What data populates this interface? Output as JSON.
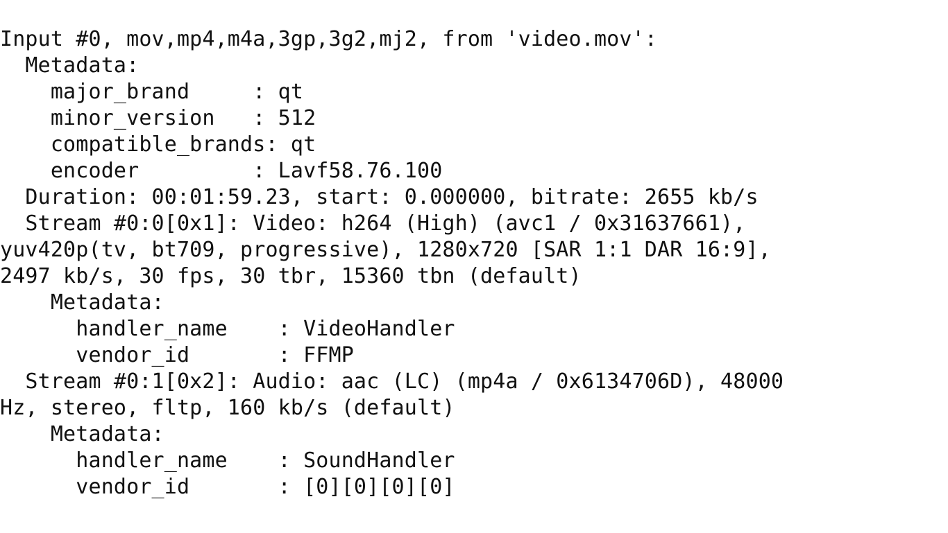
{
  "terminal": {
    "kind": "ffprobe-input-report",
    "font_family": "monospace",
    "foreground_color": "#111111",
    "background_color": "#ffffff",
    "source_file": "video.mov",
    "lines": [
      "Input #0, mov,mp4,m4a,3gp,3g2,mj2, from 'video.mov':",
      "  Metadata:",
      "    major_brand     : qt",
      "    minor_version   : 512",
      "    compatible_brands: qt",
      "    encoder         : Lavf58.76.100",
      "  Duration: 00:01:59.23, start: 0.000000, bitrate: 2655 kb/s",
      "  Stream #0:0[0x1]: Video: h264 (High) (avc1 / 0x31637661),",
      "yuv420p(tv, bt709, progressive), 1280x720 [SAR 1:1 DAR 16:9],",
      "2497 kb/s, 30 fps, 30 tbr, 15360 tbn (default)",
      "    Metadata:",
      "      handler_name    : VideoHandler",
      "      vendor_id       : FFMP",
      "  Stream #0:1[0x2]: Audio: aac (LC) (mp4a / 0x6134706D), 48000",
      "Hz, stereo, fltp, 160 kb/s (default)",
      "    Metadata:",
      "      handler_name    : SoundHandler",
      "      vendor_id       : [0][0][0][0]"
    ],
    "parsed": {
      "input_index": "#0",
      "format_names": "mov,mp4,m4a,3gp,3g2,mj2",
      "container_metadata": {
        "major_brand": "qt",
        "minor_version": "512",
        "compatible_brands": "qt",
        "encoder": "Lavf58.76.100"
      },
      "duration": "00:01:59.23",
      "start": "0.000000",
      "bitrate": "2655 kb/s",
      "streams": [
        {
          "id": "#0:0[0x1]",
          "type": "Video",
          "codec": "h264",
          "profile": "High",
          "tag": "avc1 / 0x31637661",
          "pixel_format": "yuv420p(tv, bt709, progressive)",
          "resolution": "1280x720",
          "sar": "1:1",
          "dar": "16:9",
          "bitrate": "2497 kb/s",
          "fps": "30 fps",
          "tbr": "30 tbr",
          "tbn": "15360 tbn",
          "disposition": "default",
          "metadata": {
            "handler_name": "VideoHandler",
            "vendor_id": "FFMP"
          }
        },
        {
          "id": "#0:1[0x2]",
          "type": "Audio",
          "codec": "aac",
          "profile": "LC",
          "tag": "mp4a / 0x6134706D",
          "sample_rate": "48000 Hz",
          "channel_layout": "stereo",
          "sample_format": "fltp",
          "bitrate": "160 kb/s",
          "disposition": "default",
          "metadata": {
            "handler_name": "SoundHandler",
            "vendor_id": "[0][0][0][0]"
          }
        }
      ]
    }
  }
}
